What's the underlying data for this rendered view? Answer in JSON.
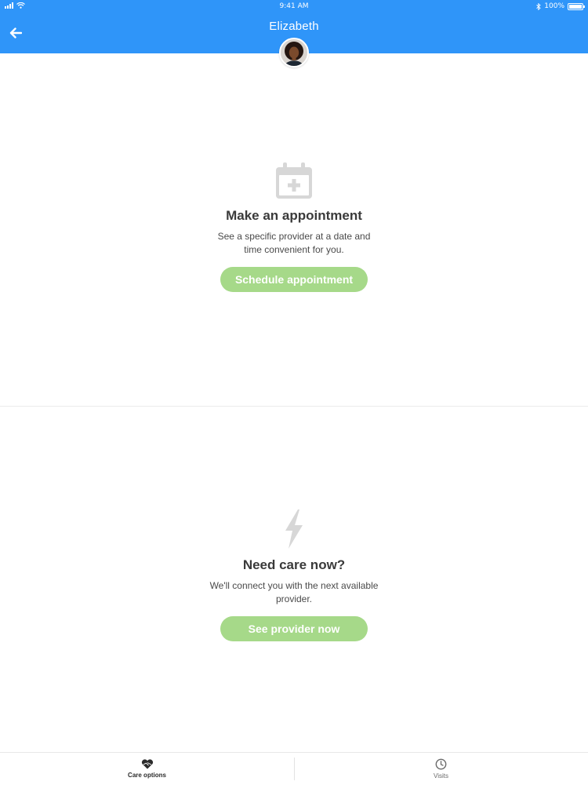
{
  "status_bar": {
    "time": "9:41 AM",
    "battery": "100%"
  },
  "header": {
    "title": "Elizabeth"
  },
  "sections": [
    {
      "icon": "calendar-plus-icon",
      "title": "Make an appointment",
      "description": "See a specific provider at a date and time convenient for you.",
      "button_label": "Schedule appointment"
    },
    {
      "icon": "lightning-bolt-icon",
      "title": "Need care now?",
      "description": "We'll connect you with the next available provider.",
      "button_label": "See provider now"
    }
  ],
  "tabs": [
    {
      "label": "Care options",
      "icon": "heart-hands-icon",
      "active": true
    },
    {
      "label": "Visits",
      "icon": "clock-icon",
      "active": false
    }
  ],
  "colors": {
    "header": "#2f95f9",
    "button": "#a6d989",
    "icon_muted": "#d7d7d7"
  }
}
